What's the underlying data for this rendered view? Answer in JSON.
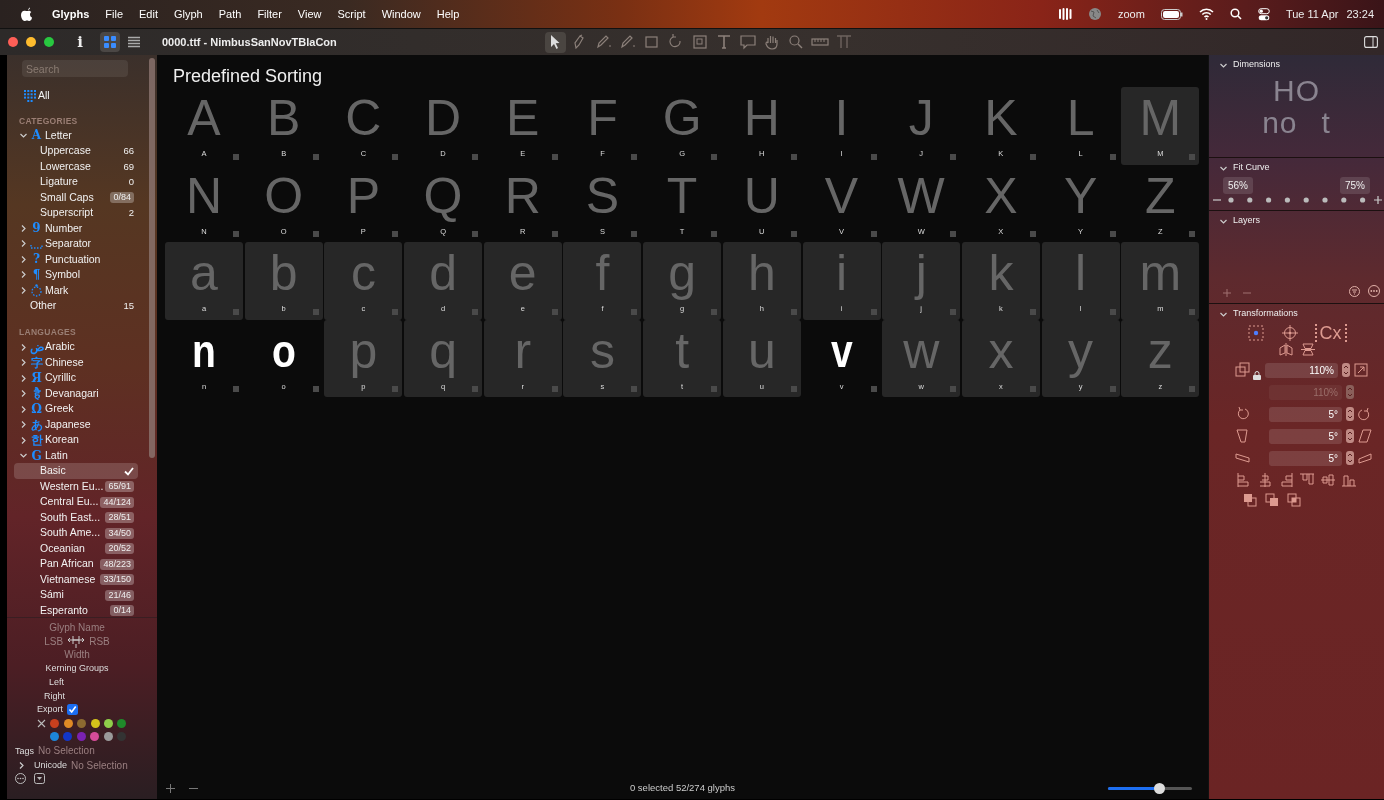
{
  "menubar": {
    "app": "Glyphs",
    "menus": [
      "File",
      "Edit",
      "Glyph",
      "Path",
      "Filter",
      "View",
      "Script",
      "Window",
      "Help"
    ],
    "status_text": "zoom",
    "date": "Tue 11 Apr",
    "time": "23:24"
  },
  "toolbar": {
    "title": "0000.ttf - NimbusSanNovTBlaCon",
    "info": "i",
    "views": [
      {
        "kind": "grid",
        "selected": true
      },
      {
        "kind": "list",
        "selected": false
      }
    ],
    "tools": [
      {
        "kind": "select",
        "selected": true
      },
      {
        "kind": "node",
        "selected": false
      },
      {
        "kind": "pen",
        "selected": false
      },
      {
        "kind": "pencil",
        "selected": false
      },
      {
        "kind": "rectangle",
        "selected": false
      },
      {
        "kind": "rotate",
        "selected": false
      },
      {
        "kind": "scale",
        "selected": false
      },
      {
        "kind": "text",
        "selected": false
      },
      {
        "kind": "annotation",
        "selected": false
      },
      {
        "kind": "hand",
        "selected": false
      },
      {
        "kind": "zoom",
        "selected": false
      },
      {
        "kind": "measure",
        "selected": false
      },
      {
        "kind": "anchor",
        "selected": false
      }
    ]
  },
  "sidebar": {
    "search": {
      "placeholder": "Search"
    },
    "all": {
      "label": "All"
    },
    "categories_heading": "CATEGORIES",
    "categories": [
      {
        "label": "Letter",
        "icon": "A",
        "expanded": true,
        "children": [
          {
            "label": "Uppercase",
            "count": "66",
            "kind": "plain"
          },
          {
            "label": "Lowercase",
            "count": "69",
            "kind": "plain"
          },
          {
            "label": "Ligature",
            "count": "0",
            "kind": "plain"
          },
          {
            "label": "Small Caps",
            "count": "0/84",
            "kind": "badge"
          },
          {
            "label": "Superscript",
            "count": "2",
            "kind": "plain"
          }
        ]
      },
      {
        "label": "Number",
        "icon": "9",
        "expanded": false
      },
      {
        "label": "Separator",
        "kind": "dots",
        "expanded": false
      },
      {
        "label": "Punctuation",
        "icon": "?",
        "expanded": false
      },
      {
        "label": "Symbol",
        "icon": "¶",
        "expanded": false
      },
      {
        "label": "Mark",
        "kind": "dotted-circle",
        "expanded": false
      },
      {
        "label": "Other",
        "count": "15",
        "kind": "plain"
      }
    ],
    "languages_heading": "LANGUAGES",
    "languages": [
      {
        "label": "Arabic",
        "icon": "ض",
        "expanded": false
      },
      {
        "label": "Chinese",
        "icon": "字",
        "expanded": false
      },
      {
        "label": "Cyrillic",
        "icon": "Я",
        "expanded": false
      },
      {
        "label": "Devanagari",
        "icon": "है",
        "expanded": false
      },
      {
        "label": "Greek",
        "icon": "Ω",
        "expanded": false
      },
      {
        "label": "Japanese",
        "icon": "あ",
        "expanded": false
      },
      {
        "label": "Korean",
        "icon": "한",
        "expanded": false
      },
      {
        "label": "Latin",
        "icon": "G",
        "expanded": true,
        "children": [
          {
            "label": "Basic",
            "selected": true
          },
          {
            "label": "Western Eu...",
            "count": "65/91",
            "kind": "badge",
            "selected": false
          },
          {
            "label": "Central Eu...",
            "count": "44/124",
            "kind": "badge",
            "selected": false
          },
          {
            "label": "South East...",
            "count": "28/51",
            "kind": "badge",
            "selected": false
          },
          {
            "label": "South Ame...",
            "count": "34/50",
            "kind": "badge",
            "selected": false
          },
          {
            "label": "Oceanian",
            "count": "20/52",
            "kind": "badge",
            "selected": false
          },
          {
            "label": "Pan African",
            "count": "48/223",
            "kind": "badge",
            "selected": false
          },
          {
            "label": "Vietnamese",
            "count": "33/150",
            "kind": "badge",
            "selected": false
          },
          {
            "label": "Sámi",
            "count": "21/46",
            "kind": "badge",
            "selected": false
          },
          {
            "label": "Esperanto",
            "count": "0/14",
            "kind": "badge",
            "selected": false
          }
        ]
      }
    ]
  },
  "info": {
    "glyph_name_placeholder": "Glyph Name",
    "lsb_placeholder": "LSB",
    "rsb_placeholder": "RSB",
    "width_placeholder": "Width",
    "kerning_heading": "Kerning Groups",
    "left_label": "Left",
    "right_label": "Right",
    "export": {
      "label": "Export",
      "checked": true
    },
    "colors": [
      {
        "color": "#c8401e"
      },
      {
        "color": "#e08a25"
      },
      {
        "color": "#8c6a30"
      },
      {
        "color": "#d4c21a"
      },
      {
        "color": "#8fce4a"
      },
      {
        "color": "#1f8a2a"
      },
      {
        "color": "#1d86d8"
      },
      {
        "color": "#1336c8"
      },
      {
        "color": "#7a22b0"
      },
      {
        "color": "#d54c98"
      },
      {
        "color": "#9a9a9a"
      },
      {
        "color": "#333333"
      }
    ],
    "tags": {
      "label": "Tags",
      "value": "No Selection"
    },
    "unicode": {
      "label": "Unicode",
      "value": "No Selection",
      "expanded": false
    }
  },
  "main": {
    "title": "Predefined Sorting",
    "status": "0 selected 52/274 glyphs",
    "zoom": {
      "level": 0.61
    },
    "glyphs": [
      {
        "char": "A",
        "name": "A",
        "highlighted": false,
        "kind": "placeholder"
      },
      {
        "char": "B",
        "name": "B",
        "highlighted": false,
        "kind": "placeholder"
      },
      {
        "char": "C",
        "name": "C",
        "highlighted": false,
        "kind": "placeholder"
      },
      {
        "char": "D",
        "name": "D",
        "highlighted": false,
        "kind": "placeholder"
      },
      {
        "char": "E",
        "name": "E",
        "highlighted": false,
        "kind": "placeholder"
      },
      {
        "char": "F",
        "name": "F",
        "highlighted": false,
        "kind": "placeholder"
      },
      {
        "char": "G",
        "name": "G",
        "highlighted": false,
        "kind": "placeholder"
      },
      {
        "char": "H",
        "name": "H",
        "highlighted": false,
        "kind": "placeholder"
      },
      {
        "char": "I",
        "name": "I",
        "highlighted": false,
        "kind": "placeholder"
      },
      {
        "char": "J",
        "name": "J",
        "highlighted": false,
        "kind": "placeholder"
      },
      {
        "char": "K",
        "name": "K",
        "highlighted": false,
        "kind": "placeholder"
      },
      {
        "char": "L",
        "name": "L",
        "highlighted": false,
        "kind": "placeholder"
      },
      {
        "char": "M",
        "name": "M",
        "highlighted": true,
        "kind": "placeholder"
      },
      {
        "char": "N",
        "name": "N",
        "highlighted": false,
        "kind": "placeholder"
      },
      {
        "char": "O",
        "name": "O",
        "highlighted": false,
        "kind": "placeholder"
      },
      {
        "char": "P",
        "name": "P",
        "highlighted": false,
        "kind": "placeholder"
      },
      {
        "char": "Q",
        "name": "Q",
        "highlighted": false,
        "kind": "placeholder"
      },
      {
        "char": "R",
        "name": "R",
        "highlighted": false,
        "kind": "placeholder"
      },
      {
        "char": "S",
        "name": "S",
        "highlighted": false,
        "kind": "placeholder"
      },
      {
        "char": "T",
        "name": "T",
        "highlighted": false,
        "kind": "placeholder"
      },
      {
        "char": "U",
        "name": "U",
        "highlighted": false,
        "kind": "placeholder"
      },
      {
        "char": "V",
        "name": "V",
        "highlighted": false,
        "kind": "placeholder"
      },
      {
        "char": "W",
        "name": "W",
        "highlighted": false,
        "kind": "placeholder"
      },
      {
        "char": "X",
        "name": "X",
        "highlighted": false,
        "kind": "placeholder"
      },
      {
        "char": "Y",
        "name": "Y",
        "highlighted": false,
        "kind": "placeholder"
      },
      {
        "char": "Z",
        "name": "Z",
        "highlighted": false,
        "kind": "placeholder"
      },
      {
        "char": "a",
        "name": "a",
        "highlighted": true,
        "kind": "placeholder"
      },
      {
        "char": "b",
        "name": "b",
        "highlighted": true,
        "kind": "placeholder"
      },
      {
        "char": "c",
        "name": "c",
        "highlighted": true,
        "kind": "placeholder"
      },
      {
        "char": "d",
        "name": "d",
        "highlighted": true,
        "kind": "placeholder"
      },
      {
        "char": "e",
        "name": "e",
        "highlighted": true,
        "kind": "placeholder"
      },
      {
        "char": "f",
        "name": "f",
        "highlighted": true,
        "kind": "placeholder"
      },
      {
        "char": "g",
        "name": "g",
        "highlighted": true,
        "kind": "placeholder"
      },
      {
        "char": "h",
        "name": "h",
        "highlighted": true,
        "kind": "placeholder"
      },
      {
        "char": "i",
        "name": "i",
        "highlighted": true,
        "kind": "placeholder"
      },
      {
        "char": "j",
        "name": "j",
        "highlighted": true,
        "kind": "placeholder"
      },
      {
        "char": "k",
        "name": "k",
        "highlighted": true,
        "kind": "placeholder"
      },
      {
        "char": "l",
        "name": "l",
        "highlighted": true,
        "kind": "placeholder"
      },
      {
        "char": "m",
        "name": "m",
        "highlighted": true,
        "kind": "placeholder"
      },
      {
        "char": "n",
        "name": "n",
        "highlighted": false,
        "kind": "drawn"
      },
      {
        "char": "o",
        "name": "o",
        "highlighted": false,
        "kind": "drawn"
      },
      {
        "char": "p",
        "name": "p",
        "highlighted": true,
        "kind": "placeholder"
      },
      {
        "char": "q",
        "name": "q",
        "highlighted": true,
        "kind": "placeholder"
      },
      {
        "char": "r",
        "name": "r",
        "highlighted": true,
        "kind": "placeholder"
      },
      {
        "char": "s",
        "name": "s",
        "highlighted": true,
        "kind": "placeholder"
      },
      {
        "char": "t",
        "name": "t",
        "highlighted": true,
        "kind": "placeholder"
      },
      {
        "char": "u",
        "name": "u",
        "highlighted": true,
        "kind": "placeholder"
      },
      {
        "char": "v",
        "name": "v",
        "highlighted": false,
        "kind": "drawn"
      },
      {
        "char": "w",
        "name": "w",
        "highlighted": true,
        "kind": "placeholder"
      },
      {
        "char": "x",
        "name": "x",
        "highlighted": true,
        "kind": "placeholder"
      },
      {
        "char": "y",
        "name": "y",
        "highlighted": true,
        "kind": "placeholder"
      },
      {
        "char": "z",
        "name": "z",
        "highlighted": true,
        "kind": "placeholder"
      }
    ]
  },
  "inspector": {
    "dimensions": {
      "title": "Dimensions",
      "expanded": true,
      "samples": [
        "HO",
        "no",
        "t"
      ]
    },
    "fit_curve": {
      "title": "Fit Curve",
      "expanded": true,
      "low": "56%",
      "high": "75%"
    },
    "layers": {
      "title": "Layers",
      "expanded": true
    },
    "transformations": {
      "title": "Transformations",
      "expanded": true,
      "origin_text": "Cx",
      "scale": "110%",
      "scale_y": {
        "value": "110%",
        "disabled": true
      },
      "rotate": "5°",
      "slant": "5°",
      "skew": "5°"
    }
  }
}
